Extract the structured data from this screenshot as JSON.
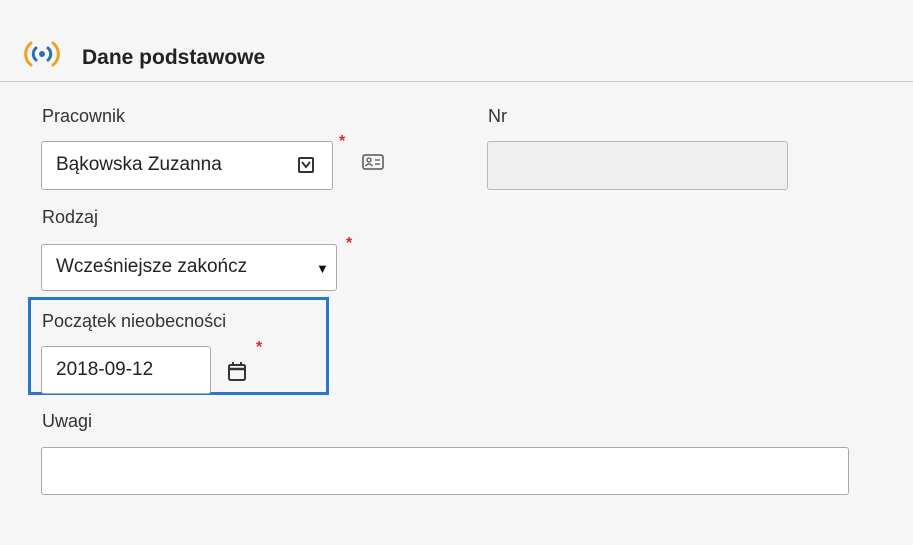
{
  "section": {
    "title": "Dane podstawowe",
    "icon": "connection-icon"
  },
  "fields": {
    "employee": {
      "label": "Pracownik",
      "value": "Bąkowska Zuzanna",
      "required_marker": "*",
      "dropdown_icon": "chevron-down-icon",
      "card_icon": "id-card-icon"
    },
    "number": {
      "label": "Nr",
      "value": ""
    },
    "type": {
      "label": "Rodzaj",
      "value": "Wcześniejsze zakończ",
      "required_marker": "*",
      "arrow": "▼"
    },
    "absence_start": {
      "label": "Początek nieobecności",
      "value": "2018-09-12",
      "required_marker": "*",
      "picker_icon": "calendar-icon"
    },
    "notes": {
      "label": "Uwagi",
      "value": ""
    }
  },
  "colors": {
    "accent": "#f0a020",
    "focus_border": "#2b78c8",
    "required": "#e0262f"
  }
}
